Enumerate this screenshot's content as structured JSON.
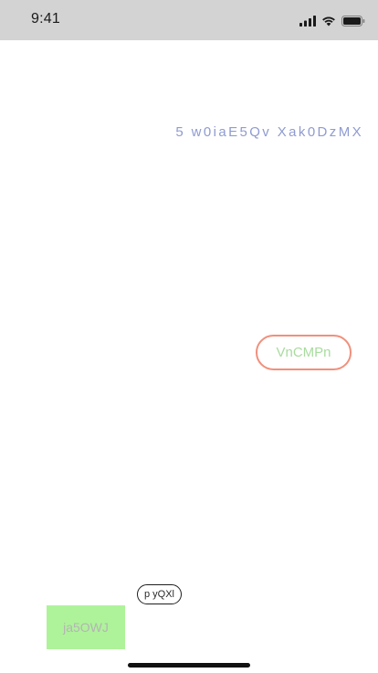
{
  "status_bar": {
    "time": "9:41",
    "icons": [
      "cellular-signal-icon",
      "wifi-icon",
      "battery-icon"
    ]
  },
  "main": {
    "header_text": "5 w0iaE5Qv Xak0DzMX",
    "pill_button_label": "VnCMPn",
    "tag_label": "p yQXl",
    "green_button_label": "ja5OWJ"
  },
  "colors": {
    "status_bar_bg": "#d3d3d3",
    "header_text": "#8f9bd0",
    "pill_border": "#f0907c",
    "pill_text": "#a8dc9e",
    "green_button_bg": "#aef39a",
    "green_button_text": "#b4b4b4"
  }
}
